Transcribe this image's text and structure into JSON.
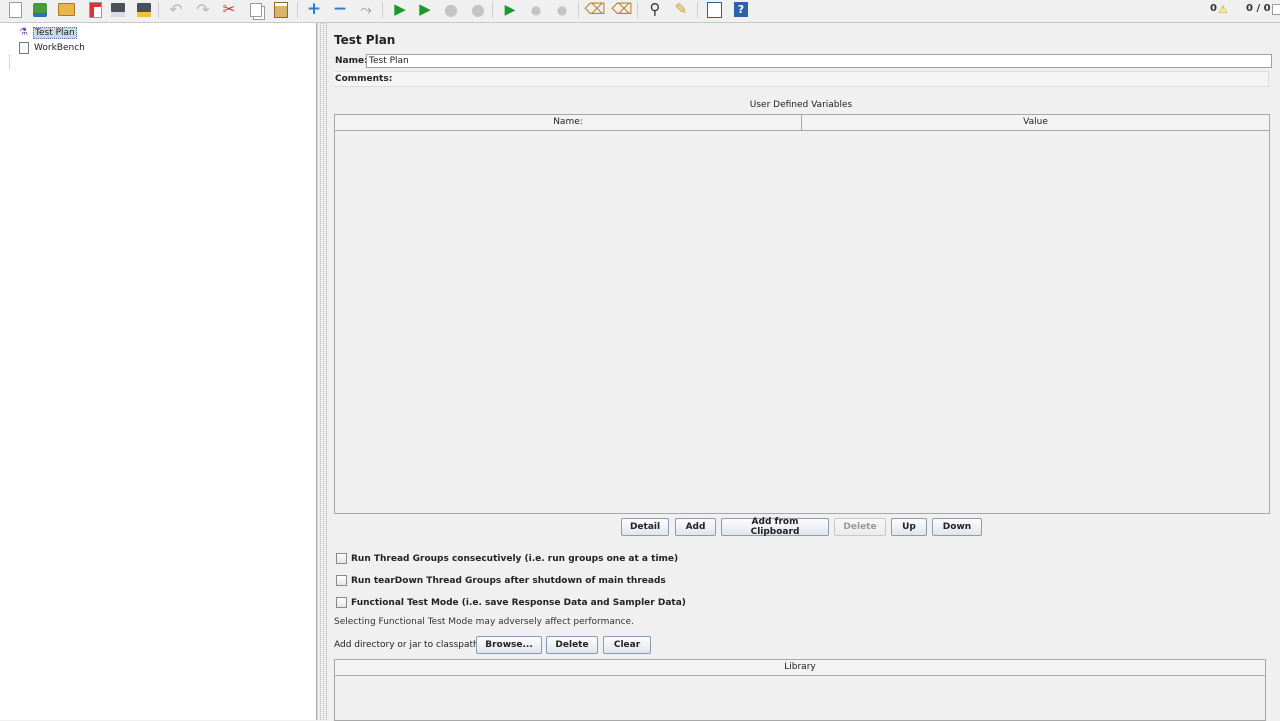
{
  "toolbar": {
    "items": [
      {
        "name": "new-icon",
        "icon": "ico-new",
        "glyph": ""
      },
      {
        "name": "templates-icon",
        "icon": "ico-templ",
        "glyph": ""
      },
      {
        "name": "open-icon",
        "icon": "ico-open",
        "glyph": ""
      },
      {
        "name": "close-icon",
        "icon": "ico-close",
        "glyph": ""
      },
      {
        "name": "save-icon",
        "icon": "ico-save",
        "glyph": ""
      },
      {
        "name": "save-as-icon",
        "icon": "ico-saveas",
        "glyph": ""
      },
      {
        "name": "undo-icon",
        "icon": "ico-undo",
        "glyph": "↶"
      },
      {
        "name": "redo-icon",
        "icon": "ico-redo",
        "glyph": "↷"
      },
      {
        "name": "cut-icon",
        "icon": "ico-cut",
        "glyph": "✂"
      },
      {
        "name": "copy-icon",
        "icon": "ico-copy",
        "glyph": ""
      },
      {
        "name": "paste-icon",
        "icon": "ico-paste",
        "glyph": ""
      },
      {
        "name": "expand-all-icon",
        "icon": "ico-expand",
        "glyph": "+"
      },
      {
        "name": "collapse-all-icon",
        "icon": "ico-collapse",
        "glyph": "−"
      },
      {
        "name": "toggle-icon",
        "icon": "ico-toggle",
        "glyph": "⤳"
      },
      {
        "name": "start-icon",
        "icon": "ico-start",
        "glyph": "▶"
      },
      {
        "name": "start-no-pauses-icon",
        "icon": "ico-startnp",
        "glyph": "▶"
      },
      {
        "name": "stop-icon",
        "icon": "ico-stop",
        "glyph": "●"
      },
      {
        "name": "shutdown-icon",
        "icon": "ico-shutdown",
        "glyph": "●"
      },
      {
        "name": "remote-start-all-icon",
        "icon": "ico-rstart",
        "glyph": "▶"
      },
      {
        "name": "remote-stop-all-icon",
        "icon": "ico-rstop",
        "glyph": "●"
      },
      {
        "name": "remote-shutdown-all-icon",
        "icon": "ico-rshut",
        "glyph": "●"
      },
      {
        "name": "clear-icon",
        "icon": "ico-clear",
        "glyph": "⌫"
      },
      {
        "name": "clear-all-icon",
        "icon": "ico-clearall",
        "glyph": "⌫"
      },
      {
        "name": "search-icon",
        "icon": "ico-search",
        "glyph": "⚲"
      },
      {
        "name": "reset-search-icon",
        "icon": "ico-reset",
        "glyph": "✎"
      },
      {
        "name": "function-helper-icon",
        "icon": "ico-func",
        "glyph": ""
      },
      {
        "name": "help-icon",
        "icon": "ico-help",
        "glyph": ""
      }
    ],
    "status_errors": "0",
    "warn_icon": "⚠",
    "status_threads": "0 / 0"
  },
  "tree": {
    "items": [
      {
        "label": "Test Plan",
        "icon": "⚗",
        "selected": true
      },
      {
        "label": "WorkBench",
        "icon": "",
        "selected": false
      }
    ]
  },
  "panel": {
    "title": "Test Plan",
    "name_label": "Name:",
    "name_value": "Test Plan",
    "comments_label": "Comments:",
    "udv_title": "User Defined Variables",
    "columns": [
      "Name:",
      "Value"
    ],
    "buttons": {
      "detail": "Detail",
      "add": "Add",
      "add_clipboard": "Add from Clipboard",
      "delete": "Delete",
      "up": "Up",
      "down": "Down"
    },
    "checkboxes": [
      "Run Thread Groups consecutively (i.e. run groups one at a time)",
      "Run tearDown Thread Groups after shutdown of main threads",
      "Functional Test Mode (i.e. save Response Data and Sampler Data)"
    ],
    "note": "Selecting Functional Test Mode may adversely affect performance.",
    "classpath_label": "Add directory or jar to classpath",
    "cp_buttons": {
      "browse": "Browse...",
      "delete": "Delete",
      "clear": "Clear"
    },
    "library_header": "Library"
  }
}
